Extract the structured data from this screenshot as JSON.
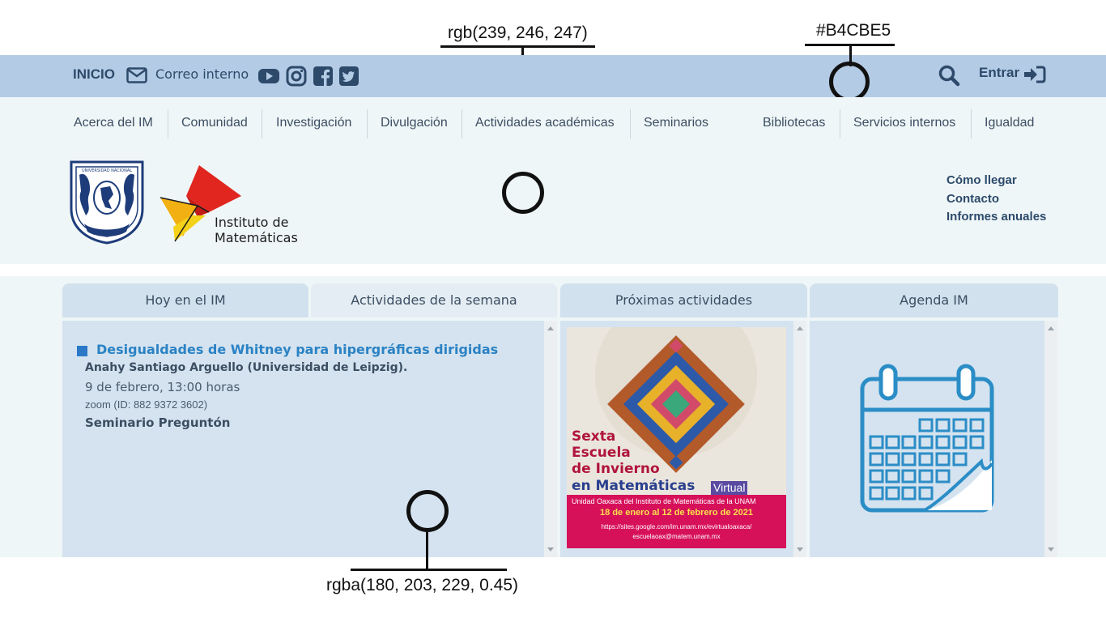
{
  "annotations": {
    "top_label": "rgb(239, 246, 247)",
    "top_right_label": "#B4CBE5",
    "bottom_label": "rgba(180, 203, 229, 0.45)"
  },
  "colors": {
    "topbar_bg": "#B4CBE5",
    "header_bg": "rgb(239, 246, 247)",
    "panel_bg": "rgba(180, 203, 229, 0.45)",
    "accent": "#2b82c4"
  },
  "topbar": {
    "home_label": "INICIO",
    "mail_icon": "envelope-icon",
    "mail_label": "Correo interno",
    "social_icons": [
      "youtube-icon",
      "instagram-icon",
      "facebook-icon",
      "twitter-icon"
    ],
    "search_icon": "search-icon",
    "login_label": "Entrar",
    "login_icon": "sign-in-icon"
  },
  "menu": {
    "items": [
      "Acerca del IM",
      "Comunidad",
      "Investigación",
      "Divulgación",
      "Actividades académicas",
      "Seminarios",
      "Bibliotecas",
      "Servicios internos",
      "Igualdad"
    ]
  },
  "institute": {
    "name_line1": "Instituto de",
    "name_line2": "Matemáticas"
  },
  "quicklinks": [
    "Cómo llegar",
    "Contacto",
    "Informes anuales"
  ],
  "tabs": [
    "Hoy en el IM",
    "Actividades de la semana",
    "Próximas actividades",
    "Agenda IM"
  ],
  "today": {
    "title": "Desigualdades de Whitney para hipergráficas dirigidas",
    "speaker": "Anahy Santiago Arguello (Universidad de Leipzig).",
    "datetime": "9 de febrero, 13:00 horas",
    "zoom": "zoom (ID: 882 9372 3602)",
    "seminar": "Seminario Preguntón"
  },
  "poster": {
    "line1": "Sexta",
    "line2": "Escuela",
    "line3": "de Invierno",
    "line4": "en Matemáticas",
    "tag": "Virtual",
    "org": "Unidad Oaxaca del Instituto de Matemáticas de la UNAM",
    "dates": "18 de enero al 12 de febrero de 2021",
    "url": "https://sites.google.com/im.unam.mx/evirtualoaxaca/",
    "email": "escuelaoax@matem.unam.mx"
  },
  "agenda": {
    "icon": "calendar-icon"
  }
}
